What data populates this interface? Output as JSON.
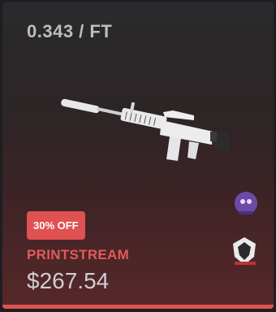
{
  "item": {
    "float_value": "0.343 / FT",
    "discount_label": "30% OFF",
    "skin_name": "PRINTSTREAM",
    "price": "$267.54"
  },
  "colors": {
    "accent": "#e05252",
    "skin_name": "#e35a58",
    "float_text": "#bdbdc0",
    "price_text": "#cfcfd2"
  },
  "icons": [
    "weapon-image",
    "sticker-ghost-icon",
    "sticker-g2-icon"
  ]
}
